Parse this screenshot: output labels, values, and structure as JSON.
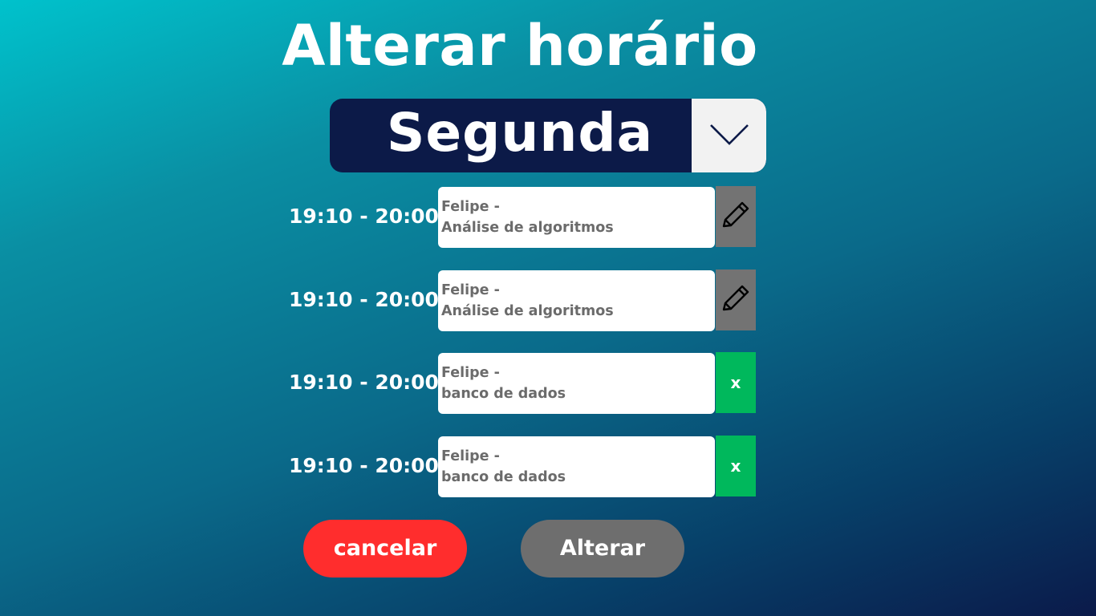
{
  "page": {
    "title": "Alterar horário"
  },
  "day_selector": {
    "selected": "Segunda",
    "toggle_icon": "chevron-down-icon"
  },
  "schedule": [
    {
      "time": "19:10 - 20:00",
      "line1": "Felipe -",
      "line2": "Análise de algoritmos",
      "action": "edit",
      "action_icon": "pencil-icon"
    },
    {
      "time": "19:10 - 20:00",
      "line1": "Felipe -",
      "line2": "Análise de algoritmos",
      "action": "edit",
      "action_icon": "pencil-icon"
    },
    {
      "time": "19:10 - 20:00",
      "line1": "Felipe -",
      "line2": "banco de dados",
      "action": "remove",
      "action_label": "x"
    },
    {
      "time": "19:10 - 20:00",
      "line1": "Felipe -",
      "line2": "banco de dados",
      "action": "remove",
      "action_label": "x"
    }
  ],
  "buttons": {
    "cancel": "cancelar",
    "confirm": "Alterar"
  },
  "colors": {
    "cancel": "#ff2d2d",
    "confirm": "#6e6e6e",
    "edit_action": "#737373",
    "remove_action": "#00b85c",
    "selector_bg": "#0c1a48"
  }
}
